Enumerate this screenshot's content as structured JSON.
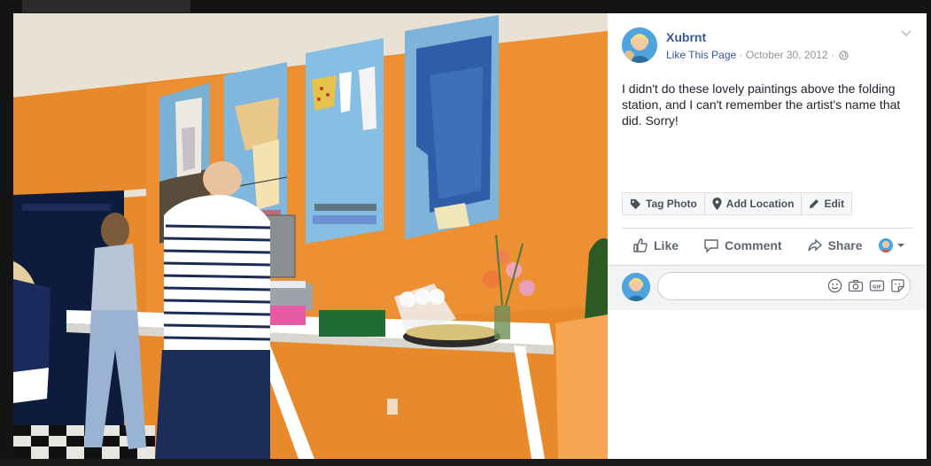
{
  "post": {
    "author": "Xubrnt",
    "like_page": "Like This Page",
    "separator": "·",
    "date": "October 30, 2012",
    "text": "I didn't do these lovely paintings above the folding station, and I can't remember the artist's name that did. Sorry!"
  },
  "actions": {
    "tag": "Tag Photo",
    "location": "Add Location",
    "edit": "Edit"
  },
  "reactions": {
    "like": "Like",
    "comment": "Comment",
    "share": "Share"
  },
  "comment_box": {
    "placeholder": ""
  },
  "icons": [
    "chevron-down-icon",
    "globe-icon",
    "tag-icon",
    "pin-icon",
    "pencil-icon",
    "thumbs-up-icon",
    "comment-icon",
    "share-icon",
    "emoji-icon",
    "camera-icon",
    "gif-icon",
    "sticker-icon"
  ],
  "colors": {
    "link": "#365899",
    "meta": "#90949c",
    "text": "#1d2129",
    "wall": "#e88a2e"
  }
}
